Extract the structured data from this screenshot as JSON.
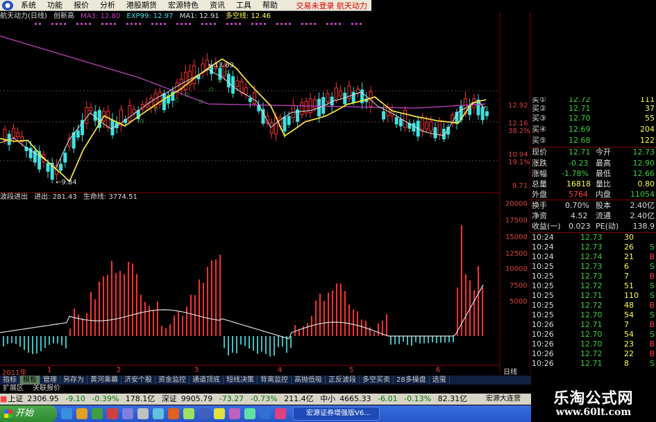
{
  "menu": {
    "items": [
      "系统",
      "功能",
      "报价",
      "分析",
      "港股期货",
      "宏源特色",
      "资讯",
      "工具",
      "帮助"
    ],
    "right_text": "交易未登录",
    "right_stock": "航天动力"
  },
  "header": {
    "name": "航天动力(日线)",
    "tag": "创新高",
    "ma3": "MA3: 12.80",
    "exp99": "EXP99: 12.97",
    "ma1": "MA1: 12.91",
    "duokong": "多空线: 12.46"
  },
  "indicator_header": {
    "name": "波段进出",
    "jinchu": "进出: 281.43",
    "shengming": "生命线: 3774.51"
  },
  "price_axis": [
    "12.92",
    "12.16",
    "38.2%",
    "10.94",
    "19.1%",
    "9.71"
  ],
  "indicator_axis": [
    "20000",
    "17500",
    "15000",
    "12500",
    "10000",
    "7500",
    "5000"
  ],
  "annotations": {
    "high": "13.69",
    "low": "9.84"
  },
  "x_labels": [
    "2011年",
    "1",
    "2",
    "3",
    "4",
    "5",
    "6"
  ],
  "daily_label": "日线",
  "quote": {
    "buy": [
      {
        "label": "买①",
        "price": "12.72",
        "vol": "111"
      },
      {
        "label": "买②",
        "price": "12.71",
        "vol": "37"
      },
      {
        "label": "买③",
        "price": "12.70",
        "vol": "55"
      },
      {
        "label": "买④",
        "price": "12.69",
        "vol": "204"
      },
      {
        "label": "买⑤",
        "price": "12.68",
        "vol": "122"
      }
    ],
    "stats": [
      {
        "l1": "现价",
        "v1": "12.71",
        "l2": "今开",
        "v2": "12.73"
      },
      {
        "l1": "涨跌",
        "v1": "-0.23",
        "l2": "最高",
        "v2": "12.90"
      },
      {
        "l1": "涨幅",
        "v1": "-1.78%",
        "l2": "最低",
        "v2": "12.66"
      },
      {
        "l1": "总量",
        "v1": "16818",
        "l2": "量比",
        "v2": "0.80"
      },
      {
        "l1": "外盘",
        "v1": "5764",
        "l2": "内盘",
        "v2": "11054"
      }
    ],
    "extra": [
      {
        "l1": "换手",
        "v1": "0.70%",
        "l2": "股本",
        "v2": "2.40亿"
      },
      {
        "l1": "净资",
        "v1": "4.52",
        "l2": "流通",
        "v2": "2.40亿"
      },
      {
        "l1": "收益(一)",
        "v1": "0.023",
        "l2": "PE(动)",
        "v2": "138.9"
      }
    ],
    "ticks": [
      {
        "time": "10:24",
        "price": "12.73",
        "vol": "30",
        "side": ""
      },
      {
        "time": "10:24",
        "price": "12.73",
        "vol": "26",
        "side": "S"
      },
      {
        "time": "10:24",
        "price": "12.74",
        "vol": "21",
        "side": "B"
      },
      {
        "time": "10:25",
        "price": "12.73",
        "vol": "6",
        "side": "S"
      },
      {
        "time": "10:25",
        "price": "12.73",
        "vol": "7",
        "side": "B"
      },
      {
        "time": "10:25",
        "price": "12.72",
        "vol": "51",
        "side": "S"
      },
      {
        "time": "10:25",
        "price": "12.71",
        "vol": "110",
        "side": "S"
      },
      {
        "time": "10:25",
        "price": "12.72",
        "vol": "48",
        "side": "B"
      },
      {
        "time": "10:25",
        "price": "12.70",
        "vol": "54",
        "side": "S"
      },
      {
        "time": "10:26",
        "price": "12.71",
        "vol": "7",
        "side": "B"
      },
      {
        "time": "10:26",
        "price": "12.70",
        "vol": "54",
        "side": "S"
      },
      {
        "time": "10:26",
        "price": "12.70",
        "vol": "23",
        "side": "B"
      },
      {
        "time": "10:26",
        "price": "12.72",
        "vol": "22",
        "side": "B"
      },
      {
        "time": "10:26",
        "price": "12.71",
        "vol": "8",
        "side": "S"
      }
    ]
  },
  "tabs": [
    "指标",
    "模板",
    "管理",
    "另存为",
    "黄河乘幕",
    "济安个股",
    "资金监控",
    "通道顶底",
    "短线决策",
    "背离监控",
    "高抛低吸",
    "正反波段",
    "多空买卖",
    "28多操盘",
    "选萤"
  ],
  "active_tab": "模板",
  "subtabs": [
    "扩展区",
    "关联报价"
  ],
  "status": {
    "sh_label": "上证",
    "sh_value": "2306.95",
    "sh_chg": "-9.10",
    "sh_pct": "-0.39%",
    "sh_amt": "178.1亿",
    "sz_label": "深证",
    "sz_value": "9905.79",
    "sz_chg": "-73.27",
    "sz_pct": "-0.73%",
    "sz_amt": "211.4亿",
    "zx_label": "中小",
    "zx_value": "4665.33",
    "zx_chg": "-6.01",
    "zx_pct": "-0.13%",
    "zx_amt": "82.31亿",
    "broker": "宏源大连营"
  },
  "taskbar": {
    "start": "开始",
    "task": "宏源证券增强版V6..."
  },
  "watermark": {
    "title": "乐淘公式网",
    "url": "www.60lt.com"
  }
}
